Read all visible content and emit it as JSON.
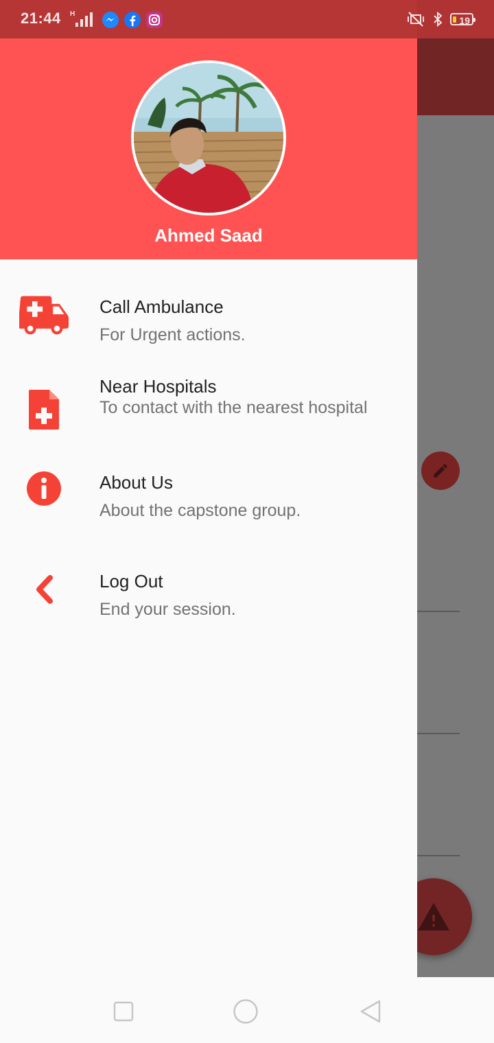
{
  "status_bar": {
    "time": "21:44",
    "signal_label": "H",
    "battery_level": "19",
    "left_icons": [
      "signal-icon",
      "messenger-icon",
      "facebook-icon",
      "instagram-icon"
    ],
    "right_icons": [
      "vibrate-off-icon",
      "bluetooth-icon",
      "battery-icon"
    ]
  },
  "drawer": {
    "user_name": "Ahmed Saad",
    "header_color": "#ff5252",
    "accent_color": "#f44336",
    "items": [
      {
        "icon": "ambulance-icon",
        "title": "Call Ambulance",
        "subtitle": "For Urgent actions."
      },
      {
        "icon": "medical-file-icon",
        "title": "Near Hospitals",
        "subtitle": "To contact with the nearest hospital"
      },
      {
        "icon": "info-icon",
        "title": "About Us",
        "subtitle": "About the capstone group."
      },
      {
        "icon": "chevron-left-icon",
        "title": "Log Out",
        "subtitle": "End your session."
      }
    ]
  },
  "background": {
    "edit_icon": "pencil-icon",
    "fab_icon": "warning-icon"
  },
  "nav_bar": {
    "buttons": [
      "recents-button",
      "home-button",
      "back-button"
    ]
  }
}
